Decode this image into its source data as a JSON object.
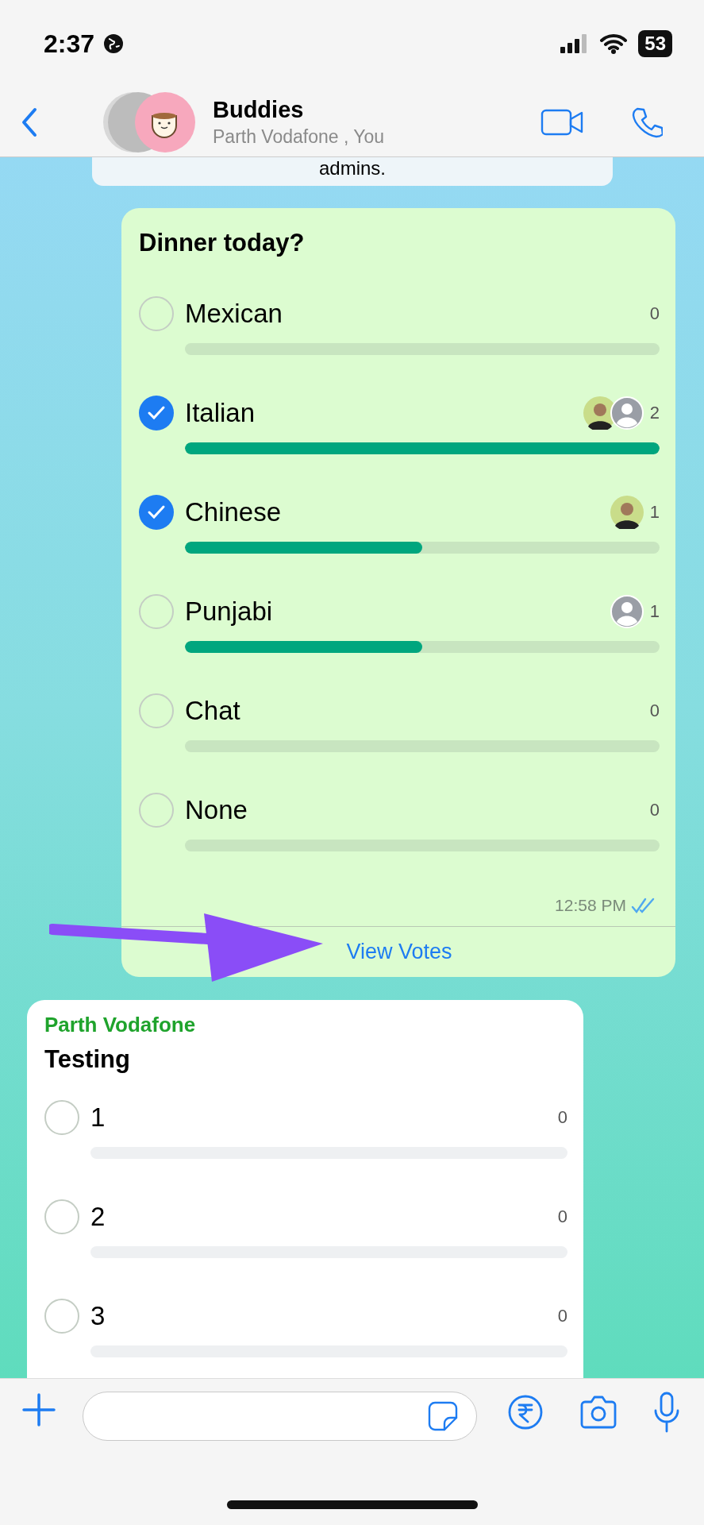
{
  "status_bar": {
    "time": "2:37",
    "battery": "53"
  },
  "header": {
    "title": "Buddies",
    "subtitle": "Parth Vodafone , You"
  },
  "system_message": {
    "text": "admins."
  },
  "poll_outgoing": {
    "question": "Dinner today?",
    "options": [
      {
        "label": "Mexican",
        "checked": false,
        "count": "0"
      },
      {
        "label": "Italian",
        "checked": true,
        "count": "2",
        "level": 1,
        "voters": [
          {
            "kind": "photo"
          },
          {
            "kind": "placeholder"
          }
        ]
      },
      {
        "label": "Chinese",
        "checked": true,
        "count": "1",
        "level": 0.5,
        "voters": [
          {
            "kind": "photo"
          }
        ]
      },
      {
        "label": "Punjabi",
        "checked": false,
        "count": "1",
        "level": 0.5,
        "voters": [
          {
            "kind": "placeholder"
          }
        ]
      },
      {
        "label": "Chat",
        "checked": false,
        "count": "0"
      },
      {
        "label": "None",
        "checked": false,
        "count": "0"
      }
    ],
    "time": "12:58 PM",
    "read": true,
    "action": "View Votes"
  },
  "poll_incoming": {
    "sender": "Parth Vodafone",
    "question": "Testing",
    "options": [
      {
        "label": "1",
        "checked": false,
        "count": "0"
      },
      {
        "label": "2",
        "checked": false,
        "count": "0"
      },
      {
        "label": "3",
        "checked": false,
        "count": "0"
      }
    ]
  }
}
